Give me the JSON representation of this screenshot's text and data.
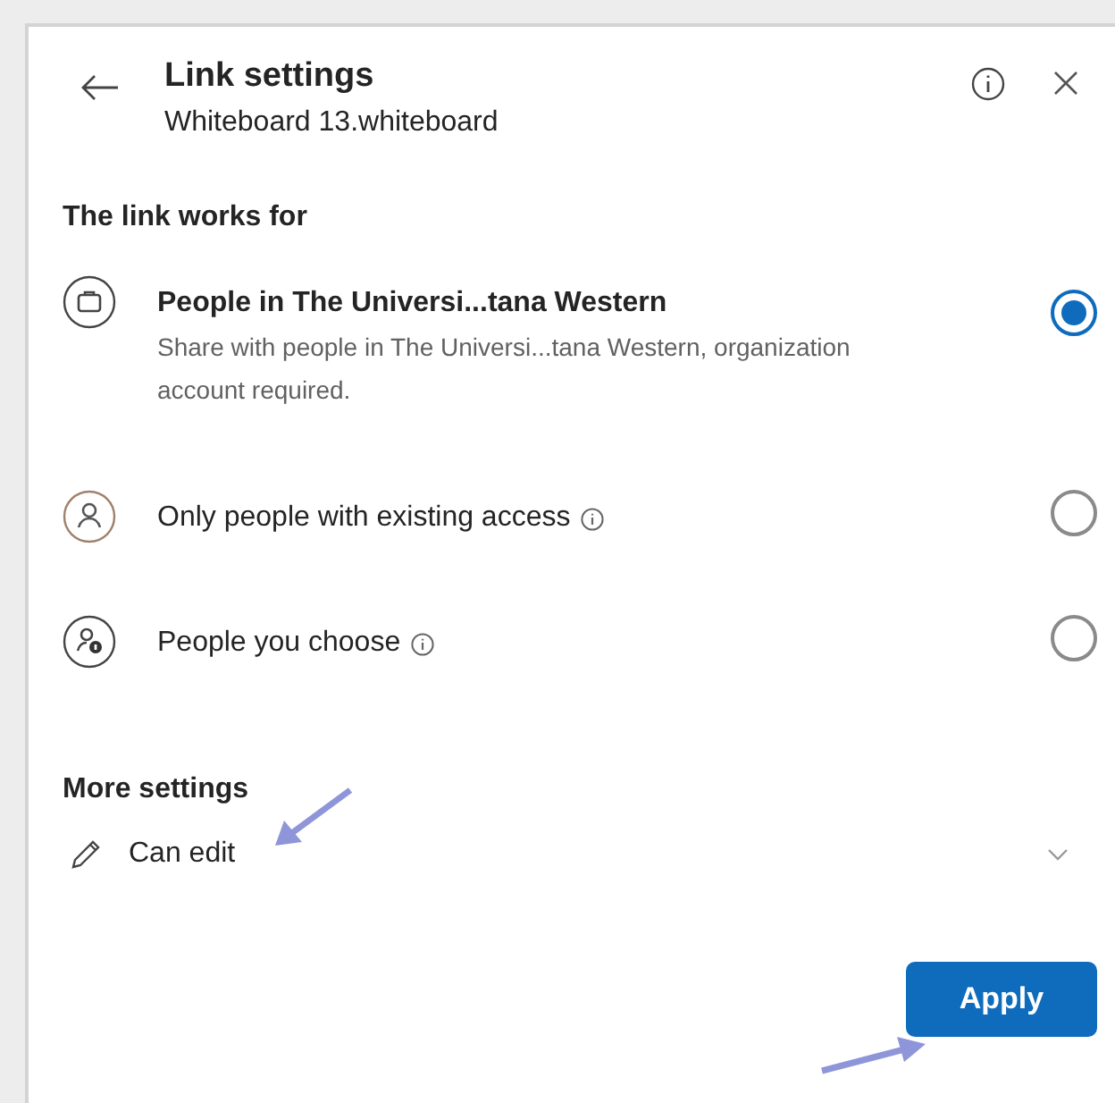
{
  "header": {
    "title": "Link settings",
    "subtitle": "Whiteboard 13.whiteboard"
  },
  "section_title": "The link works for",
  "options": [
    {
      "kind": "organization",
      "title": "People in The Universi...tana Western",
      "description": "Share with people in The Universi...tana Western, organization account required.",
      "info": false,
      "selected": true
    },
    {
      "kind": "existing",
      "title": "Only people with existing access",
      "info": true,
      "selected": false
    },
    {
      "kind": "specific",
      "title": "People you choose",
      "info": true,
      "selected": false
    }
  ],
  "more_settings": {
    "title": "More settings",
    "permission": "Can edit"
  },
  "apply_button": "Apply"
}
